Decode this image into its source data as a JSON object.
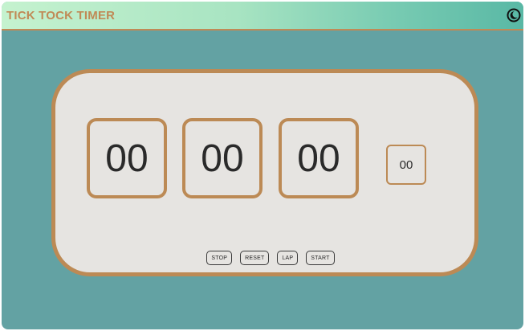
{
  "app": {
    "title": "TICK TOCK TIMER"
  },
  "header": {
    "theme_toggle_icon": "moon-icon"
  },
  "timer": {
    "hours": "00",
    "minutes": "00",
    "seconds": "00",
    "milliseconds": "00"
  },
  "controls": {
    "stop_label": "STOP",
    "reset_label": "RESET",
    "lap_label": "LAP",
    "start_label": "START"
  },
  "colors": {
    "accent": "#bc8a55",
    "background": "#63a2a3",
    "panel": "#e6e4e1",
    "header_gradient_start": "#c5f2cf",
    "header_gradient_end": "#59b8a5"
  }
}
